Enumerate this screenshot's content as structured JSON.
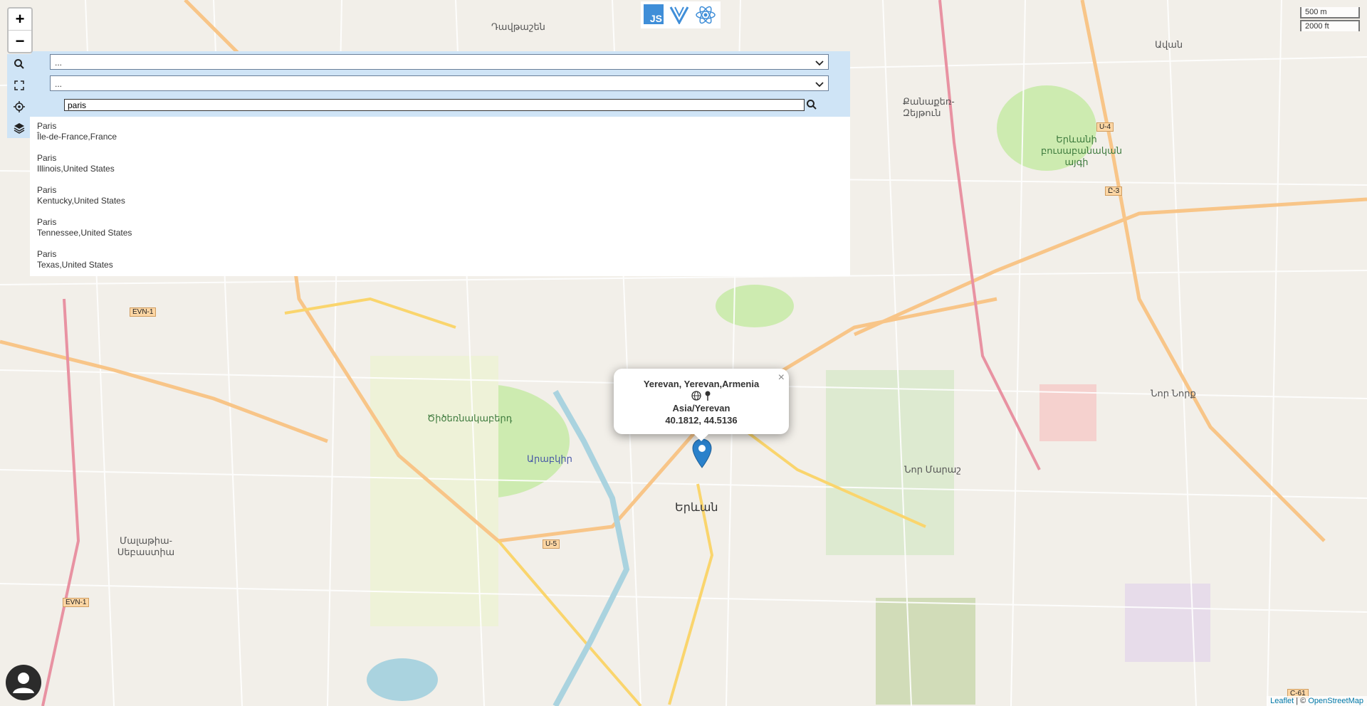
{
  "map": {
    "zoom_in_label": "+",
    "zoom_out_label": "−",
    "scale": {
      "metric": "500 m",
      "imperial": "2000 ft"
    },
    "attribution": {
      "leaflet": "Leaflet",
      "separator": " | © ",
      "osm": "OpenStreetMap"
    },
    "labels": {
      "yerevan": "Երևան",
      "davtashen": "Դավթաշեն",
      "kanaker": "Քանաքեռ-Զեյթուն",
      "avan": "Ավան",
      "nor_nork": "Նոր Նորք",
      "nor_marash": "Նոր Մարաշ",
      "tsitsernakaberd": "Ծիծեռնակաբերդ",
      "malatia": "Մալաթիա-Սեբաստիա",
      "arabkir": "Արաբկիր",
      "botanic": "Երևանի բուսաբանական այգի"
    },
    "shields": {
      "evn1a": "EVN-1",
      "evn1b": "EVN-1",
      "u4": "U-4",
      "u5": "U-5",
      "c3": "Ը-3",
      "c61": "C-61"
    }
  },
  "controls": {
    "select1_value": "...",
    "select2_value": "...",
    "search_value": "paris"
  },
  "results": [
    {
      "name": "Paris",
      "region": "Île-de-France,France"
    },
    {
      "name": "Paris",
      "region": "Illinois,United States"
    },
    {
      "name": "Paris",
      "region": "Kentucky,United States"
    },
    {
      "name": "Paris",
      "region": "Tennessee,United States"
    },
    {
      "name": "Paris",
      "region": "Texas,United States"
    }
  ],
  "popup": {
    "title": "Yerevan, Yerevan,Armenia",
    "timezone": "Asia/Yerevan",
    "coords": "40.1812, 44.5136",
    "close": "×"
  },
  "logos": {
    "js": "JS"
  }
}
